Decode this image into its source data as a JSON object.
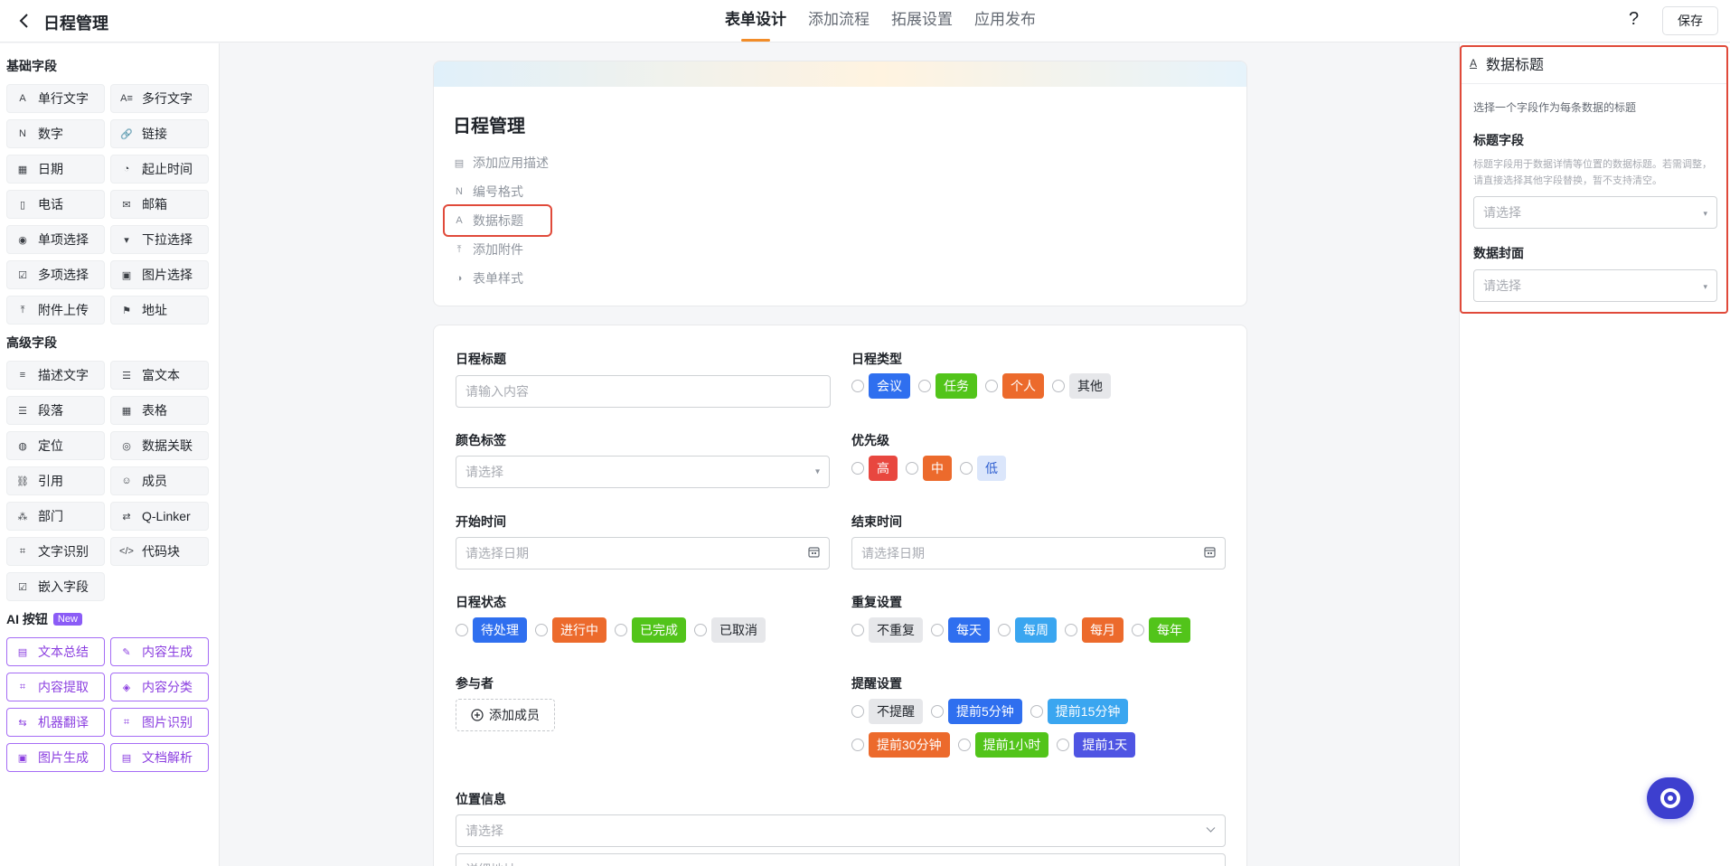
{
  "header": {
    "app_title": "日程管理",
    "tabs": [
      "表单设计",
      "添加流程",
      "拓展设置",
      "应用发布"
    ],
    "active_tab": "表单设计",
    "help": "?",
    "save_label": "保存"
  },
  "left_panel": {
    "basic_title": "基础字段",
    "basic_fields": [
      {
        "label": "单行文字",
        "icon": "single-line-text-icon",
        "glyph": "A"
      },
      {
        "label": "多行文字",
        "icon": "multi-line-text-icon",
        "glyph": "A≡"
      },
      {
        "label": "数字",
        "icon": "number-icon",
        "glyph": "N"
      },
      {
        "label": "链接",
        "icon": "link-icon",
        "glyph": "🔗"
      },
      {
        "label": "日期",
        "icon": "date-icon",
        "glyph": "▦"
      },
      {
        "label": "起止时间",
        "icon": "time-range-icon",
        "glyph": "◔"
      },
      {
        "label": "电话",
        "icon": "phone-icon",
        "glyph": "▯"
      },
      {
        "label": "邮箱",
        "icon": "mailbox-icon",
        "glyph": "✉"
      },
      {
        "label": "单项选择",
        "icon": "radio-icon",
        "glyph": "◉"
      },
      {
        "label": "下拉选择",
        "icon": "dropdown-icon",
        "glyph": "▾"
      },
      {
        "label": "多项选择",
        "icon": "checkbox-icon",
        "glyph": "☑"
      },
      {
        "label": "图片选择",
        "icon": "image-select-icon",
        "glyph": "▣"
      },
      {
        "label": "附件上传",
        "icon": "upload-icon",
        "glyph": "⤒"
      },
      {
        "label": "地址",
        "icon": "address-icon",
        "glyph": "⚑"
      }
    ],
    "advanced_title": "高级字段",
    "advanced_fields": [
      {
        "label": "描述文字",
        "icon": "description-icon",
        "glyph": "≡"
      },
      {
        "label": "富文本",
        "icon": "rich-text-icon",
        "glyph": "☰"
      },
      {
        "label": "段落",
        "icon": "paragraph-icon",
        "glyph": "☰"
      },
      {
        "label": "表格",
        "icon": "table-icon",
        "glyph": "▦"
      },
      {
        "label": "定位",
        "icon": "location-icon",
        "glyph": "◍"
      },
      {
        "label": "数据关联",
        "icon": "data-link-icon",
        "glyph": "◎"
      },
      {
        "label": "引用",
        "icon": "reference-icon",
        "glyph": "⛓"
      },
      {
        "label": "成员",
        "icon": "member-icon",
        "glyph": "☺"
      },
      {
        "label": "部门",
        "icon": "department-icon",
        "glyph": "⁂"
      },
      {
        "label": "Q-Linker",
        "icon": "qlinker-icon",
        "glyph": "⇄"
      },
      {
        "label": "文字识别",
        "icon": "ocr-icon",
        "glyph": "⌗"
      },
      {
        "label": "代码块",
        "icon": "code-block-icon",
        "glyph": "</>"
      },
      {
        "label": "嵌入字段",
        "icon": "embed-icon",
        "glyph": "☑"
      }
    ],
    "ai_title": "AI 按钮",
    "ai_badge": "New",
    "ai_fields": [
      {
        "label": "文本总结",
        "icon": "text-summary-icon",
        "glyph": "▤"
      },
      {
        "label": "内容生成",
        "icon": "content-generate-icon",
        "glyph": "✎"
      },
      {
        "label": "内容提取",
        "icon": "content-extract-icon",
        "glyph": "⌗"
      },
      {
        "label": "内容分类",
        "icon": "content-classify-icon",
        "glyph": "◈"
      },
      {
        "label": "机器翻译",
        "icon": "translate-icon",
        "glyph": "⇆"
      },
      {
        "label": "图片识别",
        "icon": "image-recognize-icon",
        "glyph": "⌗"
      },
      {
        "label": "图片生成",
        "icon": "image-generate-icon",
        "glyph": "▣"
      },
      {
        "label": "文档解析",
        "icon": "document-parse-icon",
        "glyph": "▤"
      }
    ]
  },
  "form_header": {
    "title": "日程管理",
    "options": [
      {
        "label": "添加应用描述",
        "icon": "description-icon",
        "glyph": "▤"
      },
      {
        "label": "编号格式",
        "icon": "number-format-icon",
        "glyph": "N"
      },
      {
        "label": "数据标题",
        "icon": "data-title-icon",
        "glyph": "A"
      },
      {
        "label": "添加附件",
        "icon": "attachment-icon",
        "glyph": "⤒"
      },
      {
        "label": "表单样式",
        "icon": "palette-icon",
        "glyph": "◑"
      }
    ],
    "highlighted_option": "数据标题"
  },
  "form": {
    "schedule_title": {
      "label": "日程标题",
      "placeholder": "请输入内容"
    },
    "schedule_type": {
      "label": "日程类型",
      "options": [
        {
          "text": "会议",
          "color": "#2f6fef"
        },
        {
          "text": "任务",
          "color": "#52c41a"
        },
        {
          "text": "个人",
          "color": "#ec6a2c"
        },
        {
          "text": "其他",
          "color": "#e6e7ea",
          "text_color": "#1f2329"
        }
      ]
    },
    "color_tag": {
      "label": "颜色标签",
      "placeholder": "请选择"
    },
    "priority": {
      "label": "优先级",
      "options": [
        {
          "text": "高",
          "color": "#e8473f"
        },
        {
          "text": "中",
          "color": "#ec6a2c"
        },
        {
          "text": "低",
          "color": "#dbe6fb",
          "text_color": "#2f5fd0"
        }
      ]
    },
    "start_time": {
      "label": "开始时间",
      "placeholder": "请选择日期"
    },
    "end_time": {
      "label": "结束时间",
      "placeholder": "请选择日期"
    },
    "schedule_status": {
      "label": "日程状态",
      "options": [
        {
          "text": "待处理",
          "color": "#2f6fef"
        },
        {
          "text": "进行中",
          "color": "#ec6a2c"
        },
        {
          "text": "已完成",
          "color": "#52c41a"
        },
        {
          "text": "已取消",
          "color": "#e6e7ea",
          "text_color": "#1f2329"
        }
      ]
    },
    "repeat": {
      "label": "重复设置",
      "options": [
        {
          "text": "不重复",
          "color": "#e6e7ea",
          "text_color": "#1f2329"
        },
        {
          "text": "每天",
          "color": "#2f6fef"
        },
        {
          "text": "每周",
          "color": "#3aa6f0"
        },
        {
          "text": "每月",
          "color": "#ec6a2c"
        },
        {
          "text": "每年",
          "color": "#52c41a"
        }
      ]
    },
    "participants": {
      "label": "参与者",
      "button": "添加成员"
    },
    "reminder": {
      "label": "提醒设置",
      "row1": [
        {
          "text": "不提醒",
          "color": "#e6e7ea",
          "text_color": "#1f2329"
        },
        {
          "text": "提前5分钟",
          "color": "#2f6fef"
        },
        {
          "text": "提前15分钟",
          "color": "#3aa6f0"
        }
      ],
      "row2": [
        {
          "text": "提前30分钟",
          "color": "#ec6a2c"
        },
        {
          "text": "提前1小时",
          "color": "#52c41a"
        },
        {
          "text": "提前1天",
          "color": "#4f55e3"
        }
      ]
    },
    "location": {
      "label": "位置信息",
      "placeholder": "请选择",
      "detail_placeholder": "详细地址"
    }
  },
  "right_panel": {
    "title": "数据标题",
    "description": "选择一个字段作为每条数据的标题",
    "title_field_label": "标题字段",
    "title_field_note": "标题字段用于数据详情等位置的数据标题。若需调整，请直接选择其他字段替换，暂不支持清空。",
    "title_field_placeholder": "请选择",
    "cover_label": "数据封面",
    "cover_placeholder": "请选择"
  },
  "colors": {
    "accent": "#f28c28",
    "highlight": "#e04a3a",
    "ai_purple": "#8b3fe0"
  }
}
